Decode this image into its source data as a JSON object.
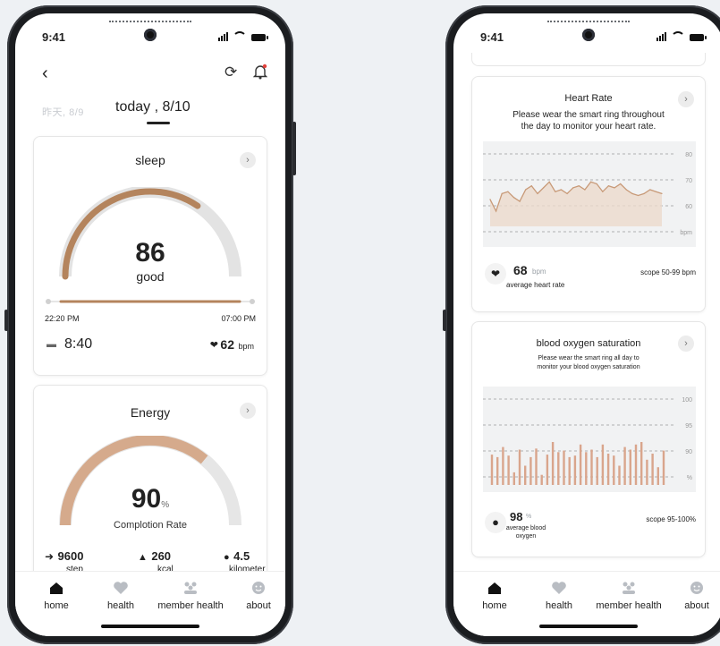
{
  "status": {
    "time": "9:41"
  },
  "left": {
    "dates": {
      "prev": "昨天, 8/9",
      "current": "today , 8/10"
    },
    "sleep": {
      "title": "sleep",
      "score": "86",
      "score_fraction": 0.86,
      "quality": "good",
      "start_time": "22:20 PM",
      "end_time": "07:00 PM",
      "duration": "8:40",
      "heart_rate": "62",
      "heart_unit": "bpm"
    },
    "energy": {
      "title": "Energy",
      "value": "90",
      "unit": "%",
      "completion_fraction": 0.9,
      "label": "Complotion Rate",
      "stats": [
        {
          "icon": "steps-icon",
          "value": "9600",
          "label": "step"
        },
        {
          "icon": "flame-icon",
          "value": "260",
          "label": "kcal"
        },
        {
          "icon": "location-icon",
          "value": "4.5",
          "label": "kilometer"
        }
      ]
    }
  },
  "right": {
    "heart": {
      "title": "Heart Rate",
      "desc_line1": "Please wear the smart ring throughout",
      "desc_line2": "the day to monitor your heart rate.",
      "avg_value": "68",
      "avg_unit": "bpm",
      "avg_label": "average heart rate",
      "scope": "scope 50-99 bpm"
    },
    "oxygen": {
      "title": "blood oxygen saturation",
      "desc_line1": "Please wear the smart ring all day to",
      "desc_line2": "monitor your blood oxygen saturation",
      "avg_value": "98",
      "avg_unit": "%",
      "avg_label_line1": "average blood",
      "avg_label_line2": "oxygen",
      "scope": "scope 95-100%"
    }
  },
  "nav": [
    {
      "label": "home",
      "icon": "home-icon"
    },
    {
      "label": "health",
      "icon": "heart-icon"
    },
    {
      "label": "member health",
      "icon": "members-icon"
    },
    {
      "label": "about",
      "icon": "smile-icon"
    }
  ],
  "chart_data": [
    {
      "type": "area",
      "title": "Heart Rate",
      "ylabel": "bpm",
      "y_ticks": [
        "80",
        "70",
        "60",
        "bpm"
      ],
      "ylim": [
        45,
        85
      ],
      "values": [
        57,
        51,
        60,
        61,
        58,
        56,
        62,
        64,
        60,
        63,
        66,
        61,
        62,
        60,
        63,
        64,
        62,
        66,
        65,
        61,
        64,
        63,
        65,
        62,
        60,
        59,
        60,
        62,
        61,
        60
      ],
      "colors": {
        "line": "#c89a78",
        "fill": "#ecd9cc"
      }
    },
    {
      "type": "bar",
      "title": "blood oxygen saturation",
      "y_ticks": [
        "100",
        "95",
        "90",
        "%"
      ],
      "ylim": [
        85,
        102
      ],
      "values": [
        91,
        90.5,
        92.5,
        90.8,
        87.5,
        92,
        88.8,
        90.5,
        92.2,
        87,
        91,
        93.5,
        91.5,
        91.8,
        90.5,
        90.8,
        93,
        91.5,
        92,
        90.5,
        93,
        91.2,
        90.8,
        88.8,
        92.5,
        92,
        93,
        93.5,
        90,
        91.2,
        88.5,
        91.8
      ],
      "colors": {
        "bar": "#d9a58c"
      }
    }
  ]
}
